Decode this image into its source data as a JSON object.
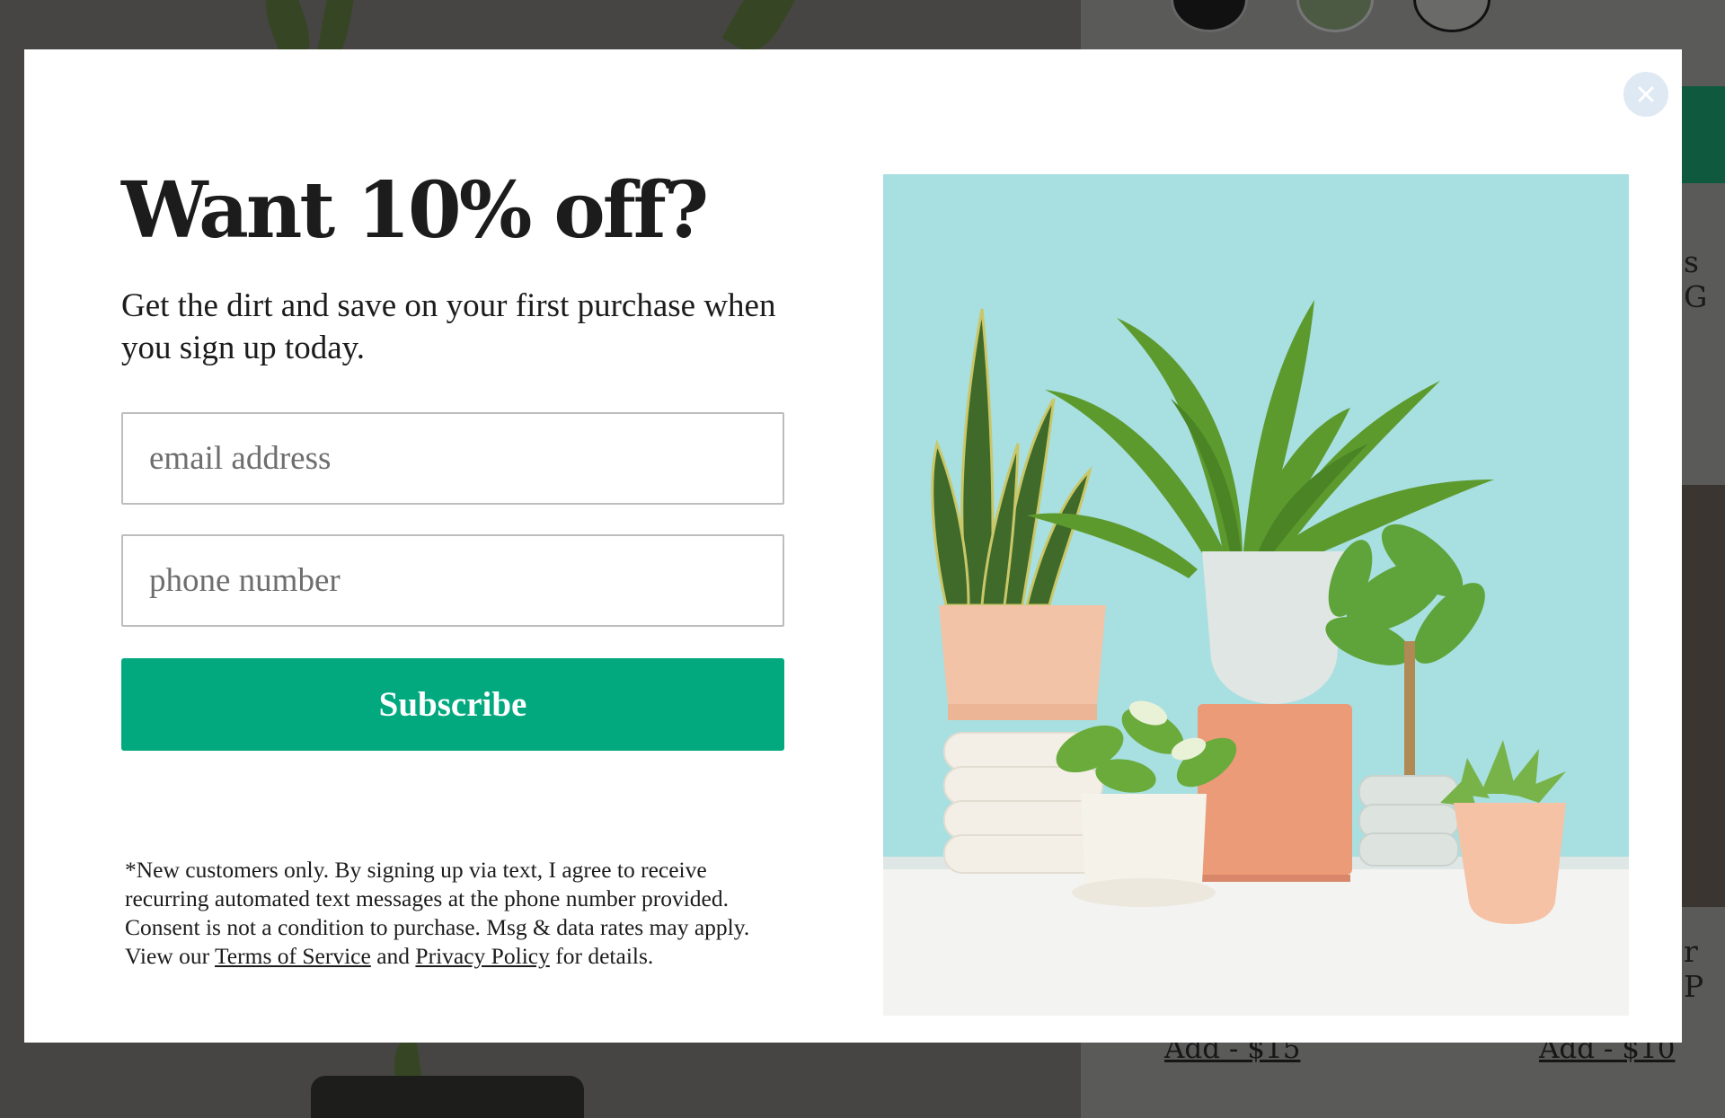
{
  "background": {
    "right_text_top": "s G",
    "right_text_bottom": "r P",
    "links": [
      "Add - $15",
      "Add - $10"
    ]
  },
  "modal": {
    "close_icon": "close-icon",
    "headline": "Want 10% off?",
    "subhead": "Get the dirt and save on your first purchase when you sign up today.",
    "email_placeholder": "email address",
    "phone_placeholder": "phone number",
    "subscribe_label": "Subscribe",
    "disclaimer_text": "*New customers only. By signing up via text, I agree to receive recurring automated text messages at the phone number provided. Consent is not a condition to purchase. Msg & data rates may apply. View our",
    "terms_link": "Terms of Service",
    "and_text": "and",
    "privacy_link": "Privacy Policy",
    "details_text": "for details."
  },
  "colors": {
    "accent": "#02a97f",
    "overlay": "#464543",
    "image_background": "#a8dfe0"
  }
}
